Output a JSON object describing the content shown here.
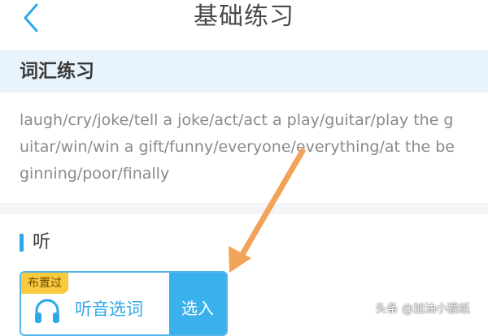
{
  "header": {
    "title": "基础练习"
  },
  "vocab_section": {
    "title": "词汇练习",
    "lines": [
      "laugh/cry/joke/tell a joke/act/act a play/guitar/play the g",
      "uitar/win/win a gift/funny/everyone/everything/at the be",
      "ginning/poor/finally"
    ]
  },
  "listen_section": {
    "label": "听",
    "card": {
      "badge": "布置过",
      "name": "听音选词",
      "select_label": "选入"
    }
  },
  "colors": {
    "accent": "#2ea8e8",
    "section_bg": "#e8f3fb",
    "badge": "#f9c93e",
    "arrow": "#f2a35a"
  },
  "icons": {
    "back": "chevron-left-icon",
    "task": "headphones-icon",
    "annotation": "arrow-annotation"
  },
  "watermark": "头条 @加油小猴纸"
}
